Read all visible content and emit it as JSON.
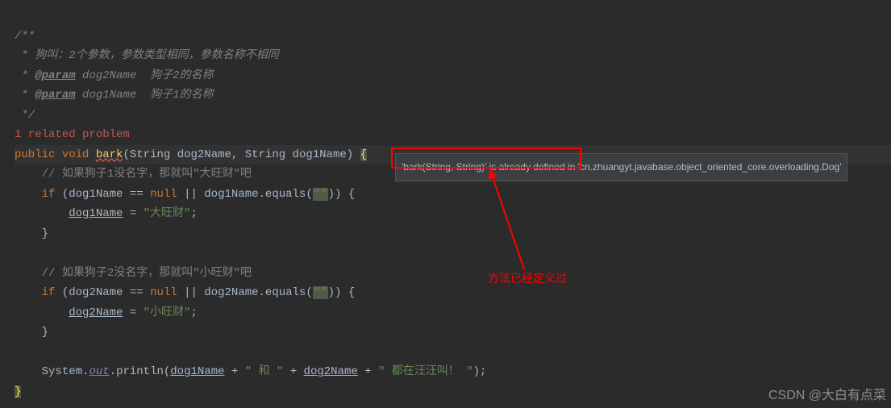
{
  "doc": {
    "open": "/**",
    "line1": " * 狗叫：2个参数，参数类型相同，参数名称不相同",
    "param_tag1": "@param",
    "param_name1": "dog2Name",
    "param_desc1": "狗子2的名称",
    "param_tag2": "@param",
    "param_name2": "dog1Name",
    "param_desc2": "狗子1的名称",
    "close": " */"
  },
  "problem_hint": "1 related problem",
  "signature": {
    "kw_public": "public",
    "kw_void": "void",
    "method": "bark",
    "type1": "String",
    "param1": "dog2Name",
    "type2": "String",
    "param2": "dog1Name"
  },
  "body": {
    "comment1": "// 如果狗子1没名字，那就叫\"大旺财\"吧",
    "if1_var": "dog1Name",
    "if1_null": "null",
    "if1_method": "equals",
    "if1_str": "\"\"",
    "assign1_var": "dog1Name",
    "assign1_val": "\"大旺财\"",
    "comment2": "// 如果狗子2没名字，那就叫\"小旺财\"吧",
    "if2_var": "dog2Name",
    "if2_null": "null",
    "if2_method": "equals",
    "if2_str": "\"\"",
    "assign2_var": "dog2Name",
    "assign2_val": "\"小旺财\"",
    "print_obj": "System",
    "print_field": "out",
    "print_method": "println",
    "print_arg1": "dog1Name",
    "print_plus": " + ",
    "print_str1": "\" 和 \"",
    "print_arg2": "dog2Name",
    "print_str2": "\" 都在汪汪叫！ \""
  },
  "tooltip": "'bark(String, String)' is already defined in 'cn.zhuangyt.javabase.object_oriented_core.overloading.Dog'",
  "annotation": "方法已经定义过",
  "watermark": "CSDN @大白有点菜"
}
